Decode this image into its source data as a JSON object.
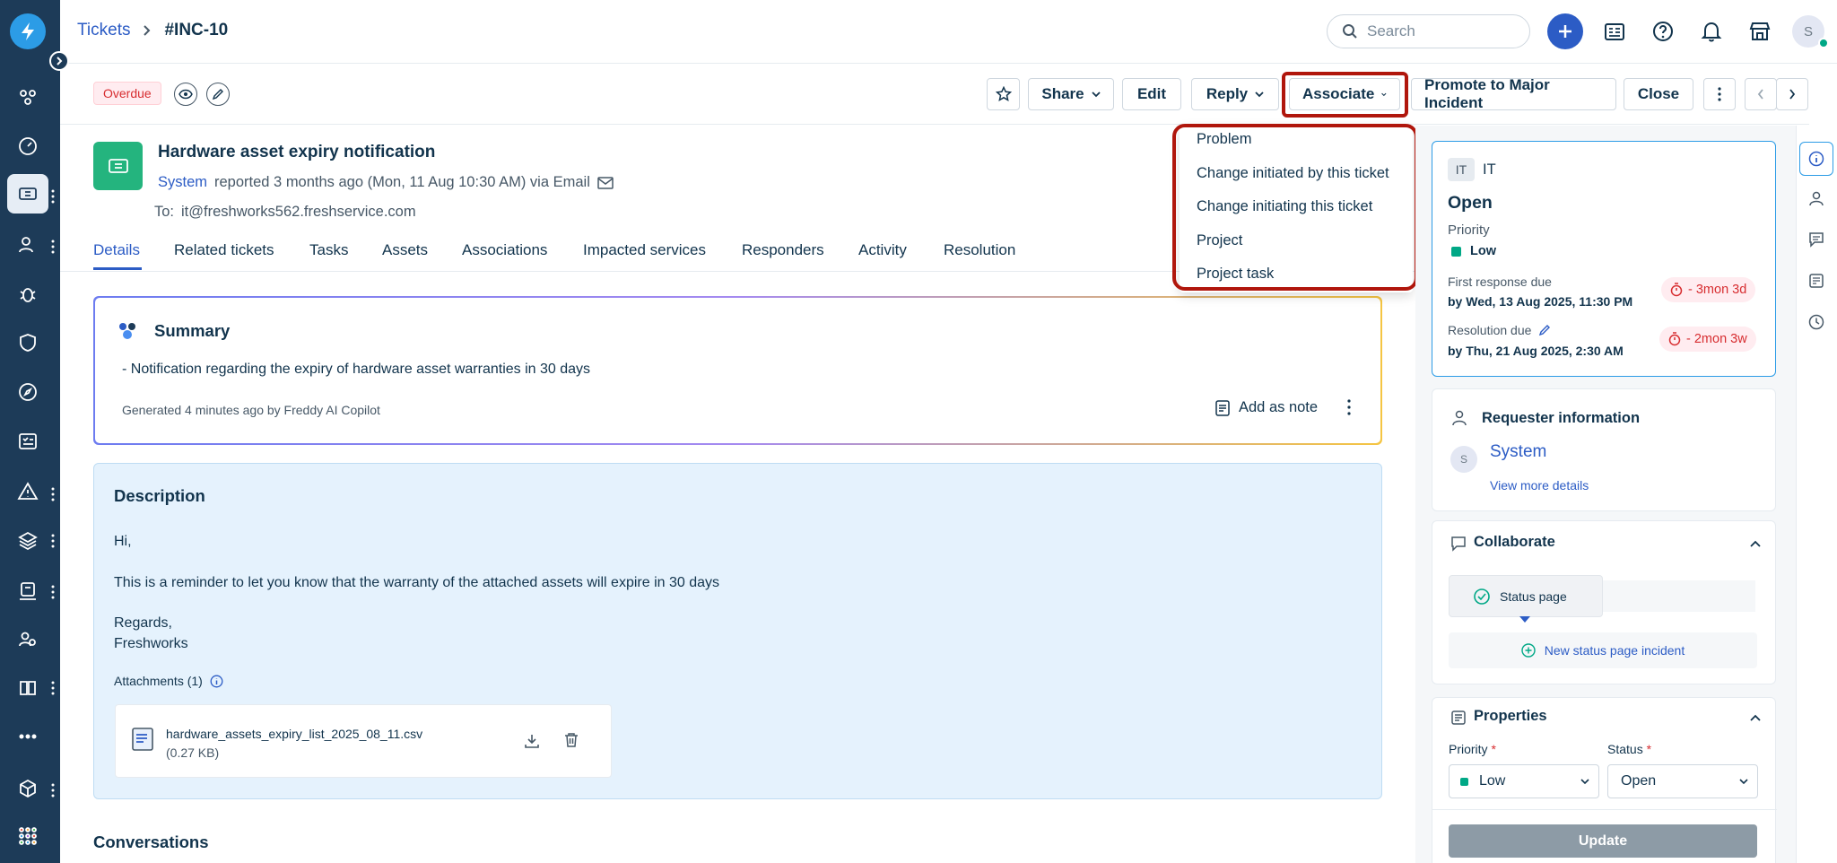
{
  "breadcrumb": {
    "parent": "Tickets",
    "current": "#INC-10"
  },
  "search": {
    "placeholder": "Search"
  },
  "header": {
    "avatar_initial": "S"
  },
  "actionbar": {
    "status_badge": "Overdue",
    "share": "Share",
    "edit": "Edit",
    "reply": "Reply",
    "associate": "Associate",
    "promote": "Promote to Major Incident",
    "close": "Close"
  },
  "associate_menu": [
    "Problem",
    "Change initiated by this ticket",
    "Change initiating this ticket",
    "Project",
    "Project task"
  ],
  "ticket": {
    "title": "Hardware asset expiry notification",
    "requester": "System",
    "meta": "reported 3 months ago (Mon, 11 Aug 10:30 AM) via Email",
    "to_label": "To:",
    "to_value": "it@freshworks562.freshservice.com"
  },
  "tabs": [
    "Details",
    "Related tickets",
    "Tasks",
    "Assets",
    "Associations",
    "Impacted services",
    "Responders",
    "Activity",
    "Resolution"
  ],
  "summary": {
    "title": "Summary",
    "text": "- Notification regarding the expiry of hardware asset warranties in 30 days",
    "generated": "Generated 4 minutes ago by Freddy AI Copilot",
    "add_note": "Add as note"
  },
  "description": {
    "title": "Description",
    "greeting": "Hi,",
    "body": "This is a reminder to let you know that the warranty of the attached assets will expire in 30 days",
    "regards": "Regards,",
    "signature": "Freshworks",
    "attachments_label": "Attachments (1)",
    "file_name": "hardware_assets_expiry_list_2025_08_11.csv",
    "file_size": "(0.27 KB)"
  },
  "conversations_title": "Conversations",
  "status_card": {
    "group_badge": "IT",
    "group": "IT",
    "status": "Open",
    "priority_label": "Priority",
    "priority": "Low",
    "first_response_label": "First response due",
    "first_response_value": "by Wed, 13 Aug 2025, 11:30 PM",
    "first_response_badge": "- 3mon 3d",
    "resolution_label": "Resolution due",
    "resolution_value": "by Thu, 21 Aug 2025, 2:30 AM",
    "resolution_badge": "- 2mon 3w"
  },
  "requester": {
    "title": "Requester information",
    "initial": "S",
    "name": "System",
    "more": "View more details"
  },
  "collaborate": {
    "title": "Collaborate",
    "status_page": "Status page",
    "new_incident": "New status page incident"
  },
  "properties": {
    "title": "Properties",
    "priority_label": "Priority",
    "status_label": "Status",
    "required_mark": "*",
    "priority_value": "Low",
    "status_value": "Open",
    "update": "Update"
  },
  "colors": {
    "accent": "#2c5cc5",
    "rail": "#1d3b58",
    "highlight": "#b0160c",
    "priority_low": "#00a886",
    "overdue": "#d72d30"
  }
}
